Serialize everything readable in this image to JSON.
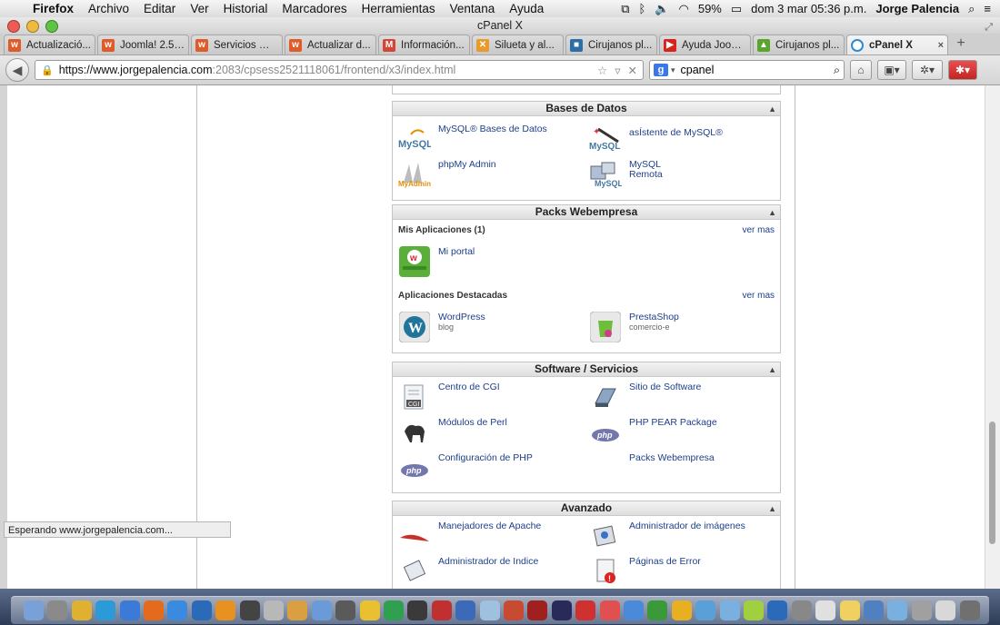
{
  "menubar": {
    "apple": "",
    "app": "Firefox",
    "items": [
      "Archivo",
      "Editar",
      "Ver",
      "Historial",
      "Marcadores",
      "Herramientas",
      "Ventana",
      "Ayuda"
    ],
    "battery": "59%",
    "clock": "dom 3 mar  05:36 p.m.",
    "user": "Jorge Palencia"
  },
  "window": {
    "title": "cPanel X"
  },
  "tabs": [
    {
      "label": "Actualizació...",
      "fav": "w",
      "color": "#e05b2a"
    },
    {
      "label": "Joomla! 2.5 ...",
      "fav": "w",
      "color": "#e05b2a"
    },
    {
      "label": "Servicios We...",
      "fav": "w",
      "color": "#e05b2a"
    },
    {
      "label": "Actualizar d...",
      "fav": "w",
      "color": "#e05b2a"
    },
    {
      "label": "Información...",
      "fav": "M",
      "color": "#d44638"
    },
    {
      "label": "Silueta y al...",
      "fav": "✕",
      "color": "#e89a2a"
    },
    {
      "label": "Cirujanos pl...",
      "fav": "■",
      "color": "#2c6fa6"
    },
    {
      "label": "Ayuda Joom...",
      "fav": "▶",
      "color": "#d8231d"
    },
    {
      "label": "Cirujanos pl...",
      "fav": "▲",
      "color": "#5ba52e"
    }
  ],
  "active_tab": {
    "label": "cPanel X",
    "fav": "◌",
    "color": "#2a8bd6"
  },
  "toolbar": {
    "url_host": "https://www.jorgepalencia.com",
    "url_path": ":2083/cpsess2521118061/frontend/x3/index.html",
    "search_value": "cpanel",
    "search_engine": "g"
  },
  "status_text": "Esperando www.jorgepalencia.com...",
  "panels": {
    "bases": {
      "title": "Bases de Datos",
      "items": [
        {
          "label": "MySQL® Bases de Datos",
          "icon": "mysql-icon"
        },
        {
          "label": "asÍstente de MySQL®",
          "icon": "mysql-wizard-icon"
        },
        {
          "label": "phpMy Admin",
          "icon": "phpmyadmin-icon"
        },
        {
          "label": "MySQL",
          "sub": "Remota",
          "icon": "remote-mysql-icon"
        }
      ]
    },
    "packs": {
      "title": "Packs Webempresa",
      "mis_apps": "Mis Aplicaciones (1)",
      "destacadas": "Aplicaciones Destacadas",
      "ver_mas": "ver mas",
      "apps": [
        {
          "label": "Mi portal",
          "icon": "joomla-icon"
        }
      ],
      "featured": [
        {
          "label": "WordPress",
          "sub": "blog",
          "icon": "wordpress-icon"
        },
        {
          "label": "PrestaShop",
          "sub": "comercio-e",
          "icon": "prestashop-icon"
        }
      ]
    },
    "software": {
      "title": "Software / Servicios",
      "items": [
        {
          "label": "Centro de CGI",
          "icon": "cgi-icon"
        },
        {
          "label": "Sitio de Software",
          "icon": "software-site-icon"
        },
        {
          "label": "Módulos de Perl",
          "icon": "perl-icon"
        },
        {
          "label": "PHP PEAR Package",
          "icon": "php-icon"
        },
        {
          "label": "Configuración de PHP",
          "icon": "php-config-icon"
        },
        {
          "label": "Packs Webempresa",
          "icon": ""
        }
      ]
    },
    "avanzado": {
      "title": "Avanzado",
      "items": [
        {
          "label": "Manejadores de Apache",
          "icon": "apache-icon"
        },
        {
          "label": "Administrador de imágenes",
          "icon": "image-manager-icon"
        },
        {
          "label": "Administrador de Indice",
          "icon": "index-manager-icon"
        },
        {
          "label": "Páginas de Error",
          "icon": "error-pages-icon"
        }
      ]
    }
  },
  "colors": {
    "link": "#1d3f8a",
    "panel_header": "#e6e6e6",
    "accent": "#2a8bd6"
  }
}
